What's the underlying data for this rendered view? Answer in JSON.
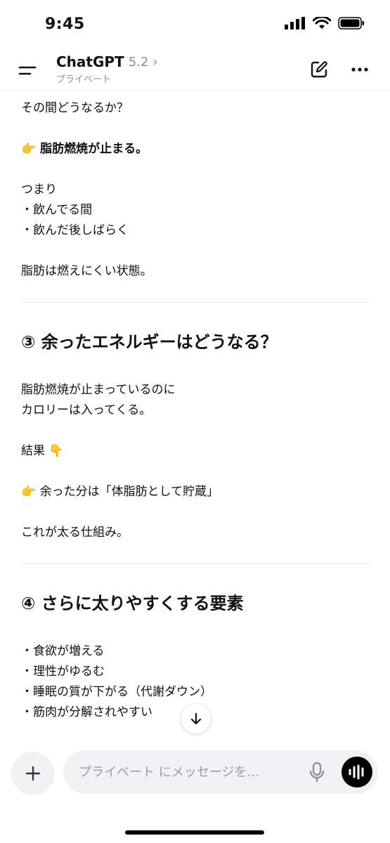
{
  "status_bar": {
    "time": "9:45"
  },
  "header": {
    "title": "ChatGPT",
    "version": "5.2",
    "chevron": "›",
    "subtitle": "プライベート",
    "icons": {
      "menu": "menu-icon",
      "compose": "compose-icon",
      "more": "more-icon"
    }
  },
  "content": {
    "p1": "その間どうなるか？",
    "p2_emoji": "👉",
    "p2_text": "脂肪燃焼が止まる。",
    "p3": [
      "つまり",
      "・飲んでる間",
      "・飲んだ後しばらく"
    ],
    "p4": "脂肪は燃えにくい状態。",
    "section3_title": "③ 余ったエネルギーはどうなる？",
    "p5": [
      "脂肪燃焼が止まっているのに",
      "カロリーは入ってくる。"
    ],
    "p6_text": "結果",
    "p6_emoji": "👇",
    "p7_emoji": "👉",
    "p7_text": "余った分は「体脂肪として貯蔵」",
    "p8": "これが太る仕組み。",
    "section4_title": "④ さらに太りやすくする要素",
    "list": [
      "・食欲が増える",
      "・理性がゆるむ",
      "・睡眠の質が下がる（代謝ダウン）",
      "・筋肉が分解されやすい"
    ]
  },
  "composer": {
    "placeholder": "プライベート にメッセージを…",
    "icons": {
      "plus": "plus-icon",
      "mic": "microphone-icon",
      "voice": "voice-mode-icon",
      "scroll": "arrow-down-icon"
    }
  },
  "colors": {
    "accent": "#000000",
    "muted": "#8e8e93",
    "pill": "#f2f2f4"
  }
}
